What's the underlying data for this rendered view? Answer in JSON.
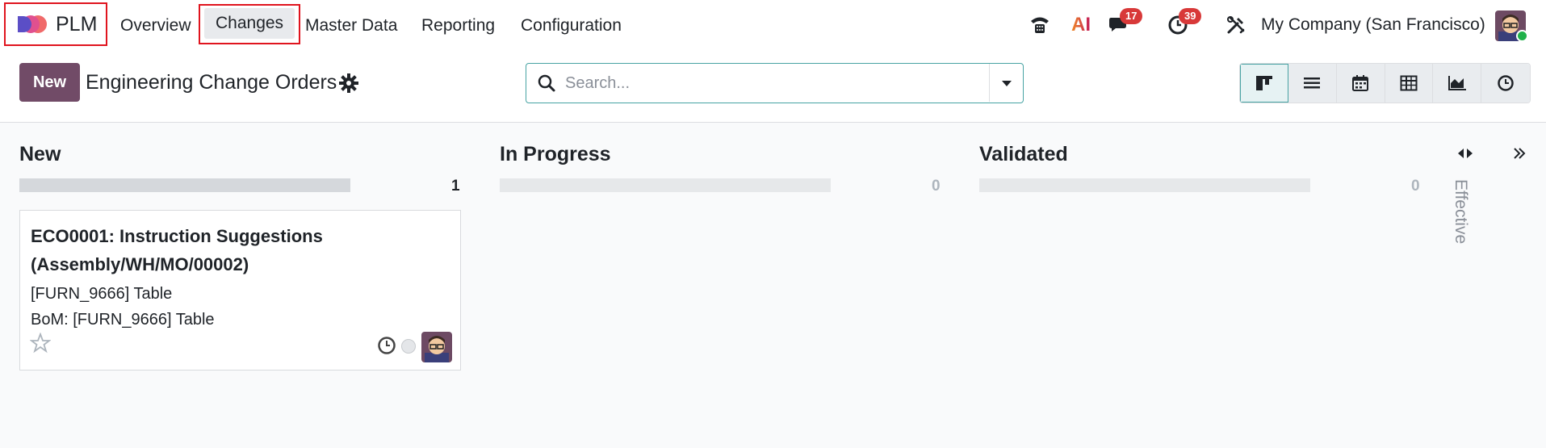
{
  "app": {
    "name": "PLM",
    "logo_icon": "plm-logo-icon"
  },
  "nav": {
    "items": [
      {
        "label": "Overview"
      },
      {
        "label": "Changes"
      },
      {
        "label": "Master Data"
      },
      {
        "label": "Reporting"
      },
      {
        "label": "Configuration"
      }
    ],
    "active": "Changes"
  },
  "systray": {
    "phone_icon": "phone-icon",
    "ai_label": "AI",
    "messages_count": "17",
    "activities_count": "39",
    "tools_icon": "tools-icon",
    "company": "My Company (San Francisco)",
    "user_status": "online"
  },
  "control_panel": {
    "new_button": "New",
    "title": "Engineering Change Orders",
    "search_placeholder": "Search...",
    "views": [
      "kanban",
      "list",
      "calendar",
      "pivot",
      "graph",
      "activity"
    ],
    "active_view": "kanban"
  },
  "kanban": {
    "columns": [
      {
        "title": "New",
        "count": "1"
      },
      {
        "title": "In Progress",
        "count": "0"
      },
      {
        "title": "Validated",
        "count": "0"
      }
    ],
    "folded_column": "Effective",
    "cards": [
      {
        "title": "ECO0001: Instruction Suggestions (Assembly/WH/MO/00002)",
        "product": "[FURN_9666] Table",
        "bom": "BoM: [FURN_9666] Table"
      }
    ]
  },
  "colors": {
    "brand": "#714b67",
    "accent": "#47a3a3",
    "badge": "#d83939",
    "highlight": "#e0141e"
  }
}
